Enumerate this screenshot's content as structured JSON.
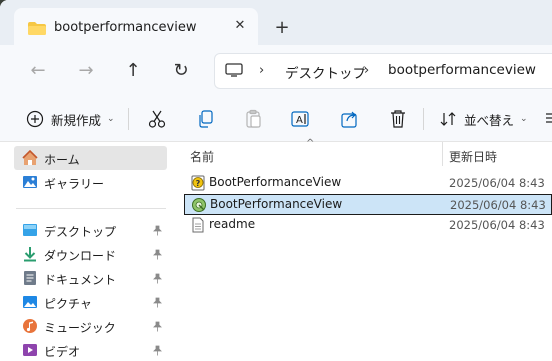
{
  "tab": {
    "title": "bootperformanceview",
    "close": "✕",
    "new_tab": "+"
  },
  "nav": {
    "back": "←",
    "forward": "→",
    "up": "↑",
    "refresh": "↻"
  },
  "address": {
    "separator": "›",
    "crumbs": [
      "デスクトップ",
      "bootperformanceview"
    ]
  },
  "toolbar": {
    "new_label": "新規作成",
    "sort_label": "並べ替え",
    "caret": "⌄"
  },
  "sidebar": {
    "items": [
      {
        "label": "ホーム",
        "icon": "home-icon",
        "selected": true
      },
      {
        "label": "ギャラリー",
        "icon": "gallery-icon"
      },
      {
        "label": "デスクトップ",
        "icon": "desktop-icon",
        "pinned": true
      },
      {
        "label": "ダウンロード",
        "icon": "download-icon",
        "pinned": true
      },
      {
        "label": "ドキュメント",
        "icon": "document-icon",
        "pinned": true
      },
      {
        "label": "ピクチャ",
        "icon": "pictures-icon",
        "pinned": true
      },
      {
        "label": "ミュージック",
        "icon": "music-icon",
        "pinned": true
      },
      {
        "label": "ビデオ",
        "icon": "video-icon",
        "pinned": true
      }
    ],
    "pin_glyph": "📌"
  },
  "columns": {
    "name": "名前",
    "modified": "更新日時",
    "sort_indicator": "^"
  },
  "files": [
    {
      "name": "BootPerformanceView",
      "date": "2025/06/04 8:43",
      "icon": "help-file-icon"
    },
    {
      "name": "BootPerformanceView",
      "date": "2025/06/04 8:43",
      "icon": "app-exe-icon",
      "selected": true
    },
    {
      "name": "readme",
      "date": "2025/06/04 8:43",
      "icon": "text-file-icon"
    }
  ],
  "colors": {
    "accent": "#0067c0",
    "selection": "#cce4f7",
    "sidebar_selected": "#e5e5e5"
  }
}
